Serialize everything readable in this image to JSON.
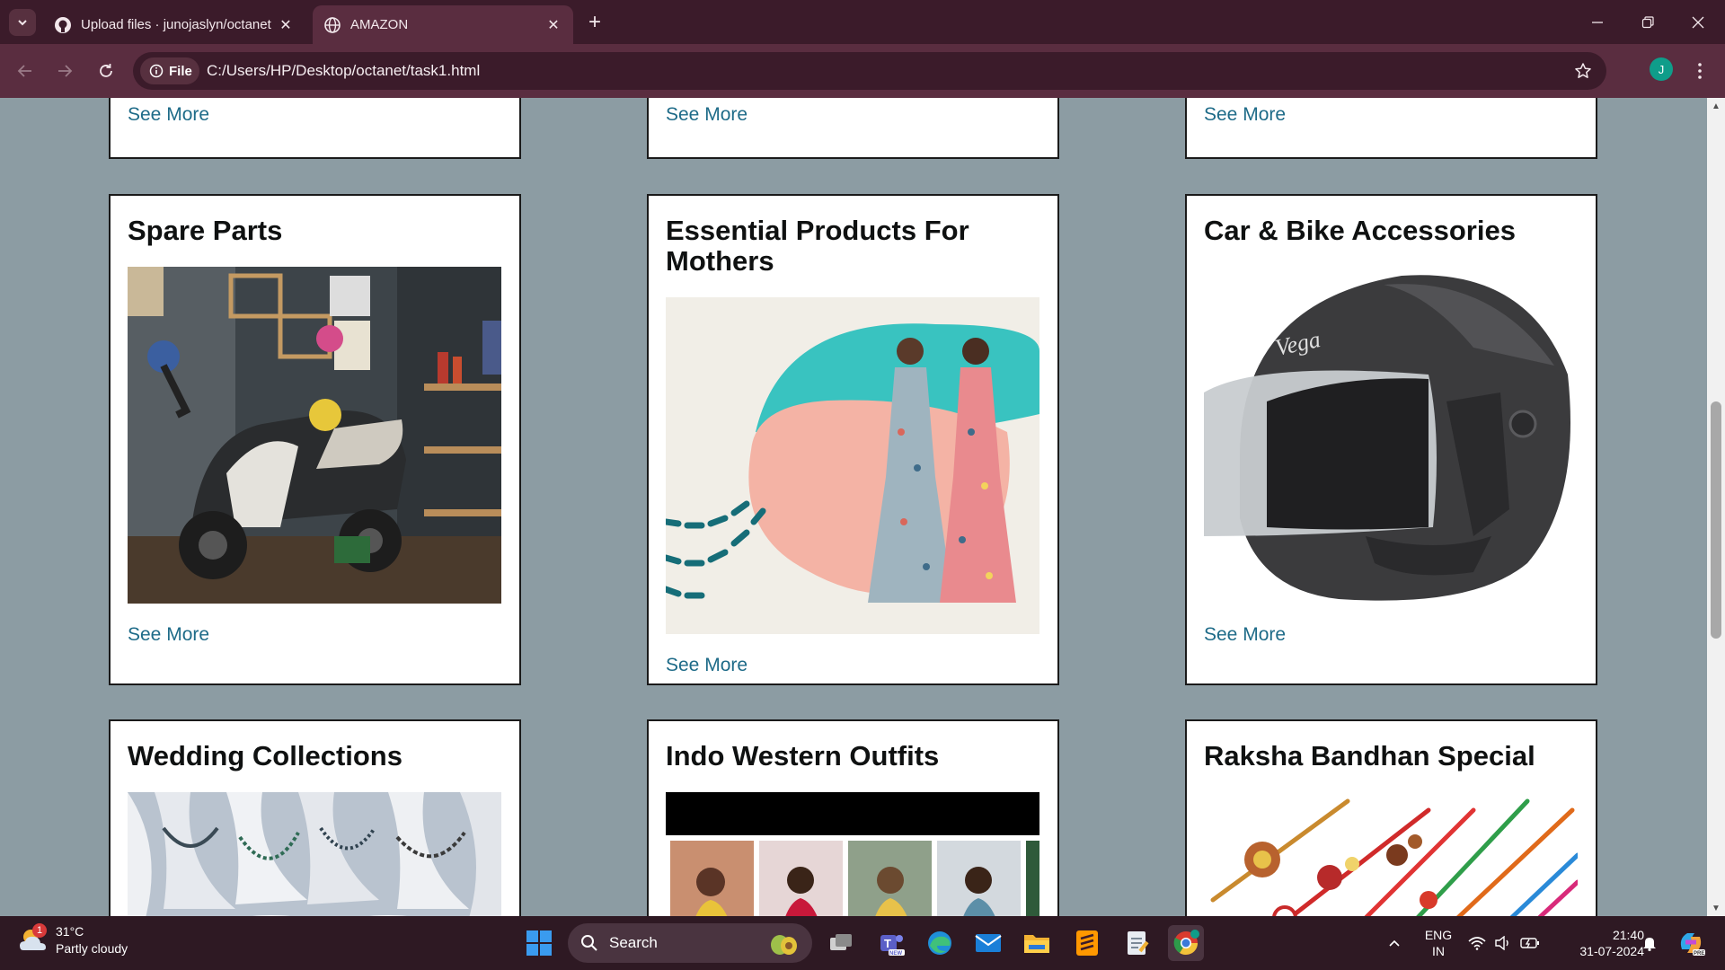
{
  "browser": {
    "tabs": [
      {
        "title": "Upload files · junojaslyn/octanet",
        "icon": "github-icon",
        "active": false
      },
      {
        "title": "AMAZON",
        "icon": "globe-icon",
        "active": true
      }
    ],
    "new_tab_label": "+",
    "site_chip": "File",
    "url": "C:/Users/HP/Desktop/octanet/task1.html",
    "profile_initial": "J"
  },
  "page": {
    "top_row_links": [
      "See More",
      "See More",
      "See More"
    ],
    "cards": [
      {
        "title": "Spare Parts",
        "link": "See More",
        "image": "scooter-workshop-image"
      },
      {
        "title": "Essential Products For Mothers",
        "link": "See More",
        "image": "maternity-dresses-image"
      },
      {
        "title": "Car & Bike Accessories",
        "link": "See More",
        "image": "helmet-image"
      },
      {
        "title": "Wedding Collections",
        "image": "jewelry-display-image"
      },
      {
        "title": "Indo Western Outfits",
        "image": "outfits-collage-image"
      },
      {
        "title": "Raksha Bandhan Special",
        "image": "rakhi-image"
      }
    ]
  },
  "taskbar": {
    "weather_temp": "31°C",
    "weather_desc": "Partly cloudy",
    "weather_badge": "1",
    "search_label": "Search",
    "lang_top": "ENG",
    "lang_bottom": "IN",
    "time": "21:40",
    "date": "31-07-2024"
  }
}
